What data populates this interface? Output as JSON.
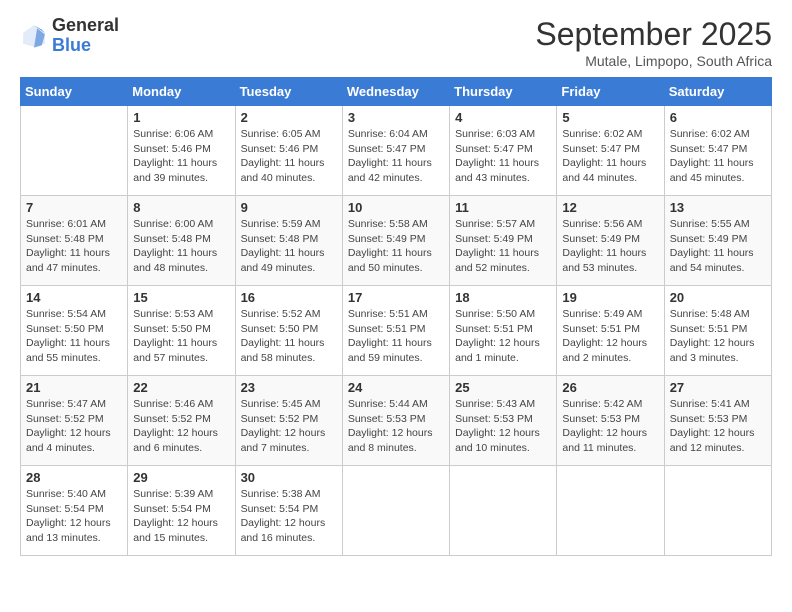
{
  "header": {
    "logo_general": "General",
    "logo_blue": "Blue",
    "month": "September 2025",
    "location": "Mutale, Limpopo, South Africa"
  },
  "weekdays": [
    "Sunday",
    "Monday",
    "Tuesday",
    "Wednesday",
    "Thursday",
    "Friday",
    "Saturday"
  ],
  "weeks": [
    [
      {
        "day": "",
        "info": ""
      },
      {
        "day": "1",
        "info": "Sunrise: 6:06 AM\nSunset: 5:46 PM\nDaylight: 11 hours\nand 39 minutes."
      },
      {
        "day": "2",
        "info": "Sunrise: 6:05 AM\nSunset: 5:46 PM\nDaylight: 11 hours\nand 40 minutes."
      },
      {
        "day": "3",
        "info": "Sunrise: 6:04 AM\nSunset: 5:47 PM\nDaylight: 11 hours\nand 42 minutes."
      },
      {
        "day": "4",
        "info": "Sunrise: 6:03 AM\nSunset: 5:47 PM\nDaylight: 11 hours\nand 43 minutes."
      },
      {
        "day": "5",
        "info": "Sunrise: 6:02 AM\nSunset: 5:47 PM\nDaylight: 11 hours\nand 44 minutes."
      },
      {
        "day": "6",
        "info": "Sunrise: 6:02 AM\nSunset: 5:47 PM\nDaylight: 11 hours\nand 45 minutes."
      }
    ],
    [
      {
        "day": "7",
        "info": "Sunrise: 6:01 AM\nSunset: 5:48 PM\nDaylight: 11 hours\nand 47 minutes."
      },
      {
        "day": "8",
        "info": "Sunrise: 6:00 AM\nSunset: 5:48 PM\nDaylight: 11 hours\nand 48 minutes."
      },
      {
        "day": "9",
        "info": "Sunrise: 5:59 AM\nSunset: 5:48 PM\nDaylight: 11 hours\nand 49 minutes."
      },
      {
        "day": "10",
        "info": "Sunrise: 5:58 AM\nSunset: 5:49 PM\nDaylight: 11 hours\nand 50 minutes."
      },
      {
        "day": "11",
        "info": "Sunrise: 5:57 AM\nSunset: 5:49 PM\nDaylight: 11 hours\nand 52 minutes."
      },
      {
        "day": "12",
        "info": "Sunrise: 5:56 AM\nSunset: 5:49 PM\nDaylight: 11 hours\nand 53 minutes."
      },
      {
        "day": "13",
        "info": "Sunrise: 5:55 AM\nSunset: 5:49 PM\nDaylight: 11 hours\nand 54 minutes."
      }
    ],
    [
      {
        "day": "14",
        "info": "Sunrise: 5:54 AM\nSunset: 5:50 PM\nDaylight: 11 hours\nand 55 minutes."
      },
      {
        "day": "15",
        "info": "Sunrise: 5:53 AM\nSunset: 5:50 PM\nDaylight: 11 hours\nand 57 minutes."
      },
      {
        "day": "16",
        "info": "Sunrise: 5:52 AM\nSunset: 5:50 PM\nDaylight: 11 hours\nand 58 minutes."
      },
      {
        "day": "17",
        "info": "Sunrise: 5:51 AM\nSunset: 5:51 PM\nDaylight: 11 hours\nand 59 minutes."
      },
      {
        "day": "18",
        "info": "Sunrise: 5:50 AM\nSunset: 5:51 PM\nDaylight: 12 hours\nand 1 minute."
      },
      {
        "day": "19",
        "info": "Sunrise: 5:49 AM\nSunset: 5:51 PM\nDaylight: 12 hours\nand 2 minutes."
      },
      {
        "day": "20",
        "info": "Sunrise: 5:48 AM\nSunset: 5:51 PM\nDaylight: 12 hours\nand 3 minutes."
      }
    ],
    [
      {
        "day": "21",
        "info": "Sunrise: 5:47 AM\nSunset: 5:52 PM\nDaylight: 12 hours\nand 4 minutes."
      },
      {
        "day": "22",
        "info": "Sunrise: 5:46 AM\nSunset: 5:52 PM\nDaylight: 12 hours\nand 6 minutes."
      },
      {
        "day": "23",
        "info": "Sunrise: 5:45 AM\nSunset: 5:52 PM\nDaylight: 12 hours\nand 7 minutes."
      },
      {
        "day": "24",
        "info": "Sunrise: 5:44 AM\nSunset: 5:53 PM\nDaylight: 12 hours\nand 8 minutes."
      },
      {
        "day": "25",
        "info": "Sunrise: 5:43 AM\nSunset: 5:53 PM\nDaylight: 12 hours\nand 10 minutes."
      },
      {
        "day": "26",
        "info": "Sunrise: 5:42 AM\nSunset: 5:53 PM\nDaylight: 12 hours\nand 11 minutes."
      },
      {
        "day": "27",
        "info": "Sunrise: 5:41 AM\nSunset: 5:53 PM\nDaylight: 12 hours\nand 12 minutes."
      }
    ],
    [
      {
        "day": "28",
        "info": "Sunrise: 5:40 AM\nSunset: 5:54 PM\nDaylight: 12 hours\nand 13 minutes."
      },
      {
        "day": "29",
        "info": "Sunrise: 5:39 AM\nSunset: 5:54 PM\nDaylight: 12 hours\nand 15 minutes."
      },
      {
        "day": "30",
        "info": "Sunrise: 5:38 AM\nSunset: 5:54 PM\nDaylight: 12 hours\nand 16 minutes."
      },
      {
        "day": "",
        "info": ""
      },
      {
        "day": "",
        "info": ""
      },
      {
        "day": "",
        "info": ""
      },
      {
        "day": "",
        "info": ""
      }
    ]
  ]
}
